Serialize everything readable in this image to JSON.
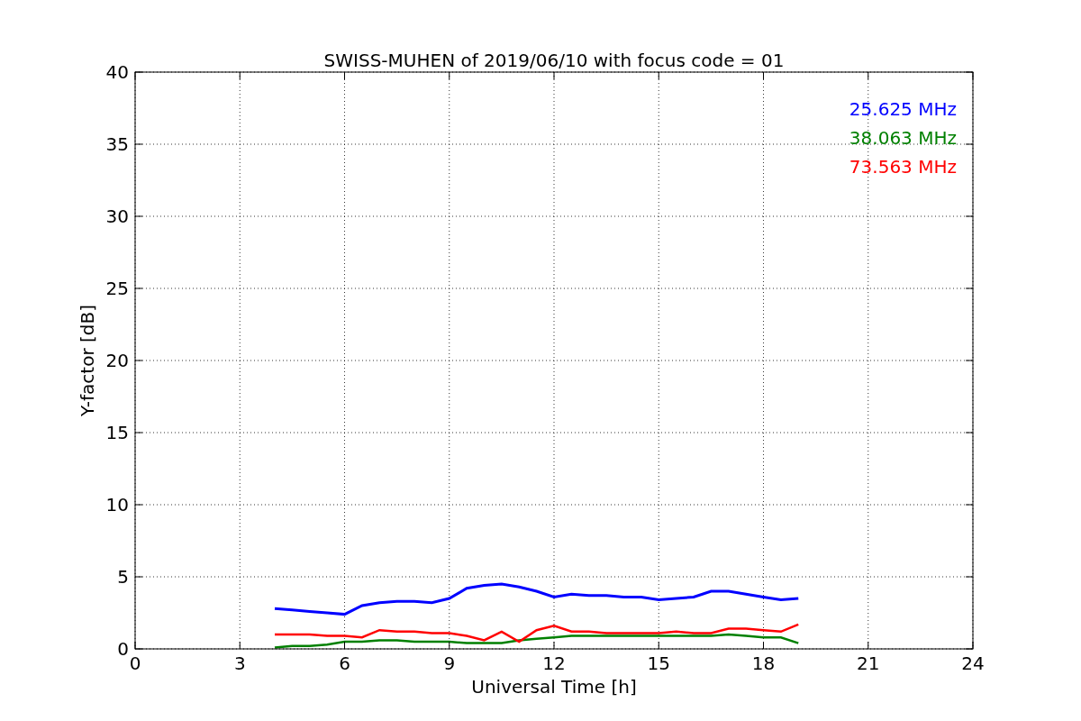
{
  "figure": {
    "chart_data": {
      "type": "line",
      "grid": true,
      "title": "SWISS-MUHEN of 2019/06/10 with focus code = 01",
      "xlabel": "Universal Time [h]",
      "ylabel": "Y-factor [dB]",
      "xlim": [
        0,
        24
      ],
      "ylim": [
        0,
        40
      ],
      "xticks": [
        0,
        3,
        6,
        9,
        12,
        15,
        18,
        21,
        24
      ],
      "yticks": [
        0,
        5,
        10,
        15,
        20,
        25,
        30,
        35,
        40
      ],
      "x": [
        4,
        4.5,
        5,
        5.5,
        6,
        6.5,
        7,
        7.5,
        8,
        8.5,
        9,
        9.5,
        10,
        10.5,
        11,
        11.5,
        12,
        12.5,
        13,
        13.5,
        14,
        14.5,
        15,
        15.5,
        16,
        16.5,
        17,
        17.5,
        18,
        18.5,
        19
      ],
      "series": [
        {
          "name": "25.625 MHz",
          "color": "#0000ff",
          "values": [
            2.8,
            2.7,
            2.6,
            2.5,
            2.4,
            3,
            3.2,
            3.3,
            3.3,
            3.2,
            3.5,
            4.2,
            4.4,
            4.5,
            4.3,
            4,
            3.6,
            3.8,
            3.7,
            3.7,
            3.6,
            3.6,
            3.4,
            3.5,
            3.6,
            4,
            4,
            3.8,
            3.6,
            3.4,
            3.5
          ]
        },
        {
          "name": "38.063 MHz",
          "color": "#008000",
          "values": [
            0.1,
            0.2,
            0.2,
            0.3,
            0.5,
            0.5,
            0.6,
            0.6,
            0.5,
            0.5,
            0.5,
            0.4,
            0.4,
            0.4,
            0.6,
            0.7,
            0.8,
            0.9,
            0.9,
            0.9,
            0.9,
            0.9,
            0.9,
            0.9,
            0.9,
            0.9,
            1,
            0.9,
            0.8,
            0.8,
            0.4
          ]
        },
        {
          "name": "73.563 MHz",
          "color": "#ff0000",
          "values": [
            1,
            1,
            1,
            0.9,
            0.9,
            0.8,
            1.3,
            1.2,
            1.2,
            1.1,
            1.1,
            0.9,
            0.6,
            1.2,
            0.5,
            1.3,
            1.6,
            1.2,
            1.2,
            1.1,
            1.1,
            1.1,
            1.1,
            1.2,
            1.1,
            1.1,
            1.4,
            1.4,
            1.3,
            1.2,
            1.7
          ]
        }
      ]
    }
  }
}
